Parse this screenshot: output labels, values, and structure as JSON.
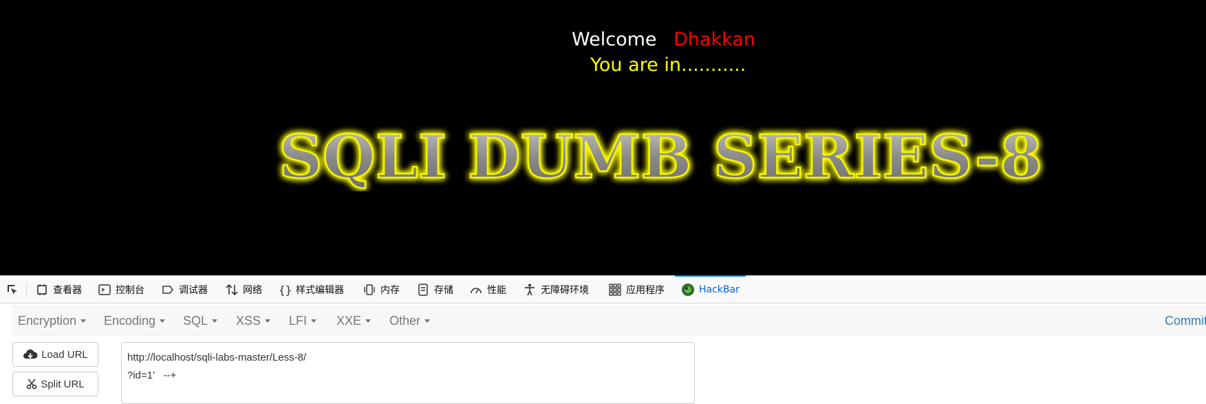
{
  "page": {
    "welcome_word": "Welcome",
    "welcome_name": "Dhakkan",
    "status": "You are in...........",
    "banner": "SQLI DUMB SERIES-8"
  },
  "devtools": {
    "tabs": [
      {
        "label": "查看器",
        "icon": "inspector-icon"
      },
      {
        "label": "控制台",
        "icon": "console-icon"
      },
      {
        "label": "调试器",
        "icon": "debugger-icon"
      },
      {
        "label": "网络",
        "icon": "network-icon"
      },
      {
        "label": "样式编辑器",
        "icon": "style-editor-icon"
      },
      {
        "label": "内存",
        "icon": "memory-icon"
      },
      {
        "label": "存储",
        "icon": "storage-icon"
      },
      {
        "label": "性能",
        "icon": "performance-icon"
      },
      {
        "label": "无障碍环境",
        "icon": "accessibility-icon"
      },
      {
        "label": "应用程序",
        "icon": "application-icon"
      },
      {
        "label": "HackBar",
        "icon": "hackbar-icon",
        "active": true
      }
    ]
  },
  "hackbar": {
    "menu": [
      "Encryption",
      "Encoding",
      "SQL",
      "XSS",
      "LFI",
      "XXE",
      "Other"
    ],
    "commit_label": "Commit ne",
    "load_url_label": "Load URL",
    "split_url_label": "Split URL",
    "url_line1": "http://localhost/sqli-labs-master/Less-8/",
    "url_line2": "?id=1'   --+"
  },
  "colors": {
    "page_bg": "#000000",
    "name": "#ff0000",
    "status": "#ffff00",
    "active_tab": "#0060df",
    "link": "#337ab7"
  }
}
